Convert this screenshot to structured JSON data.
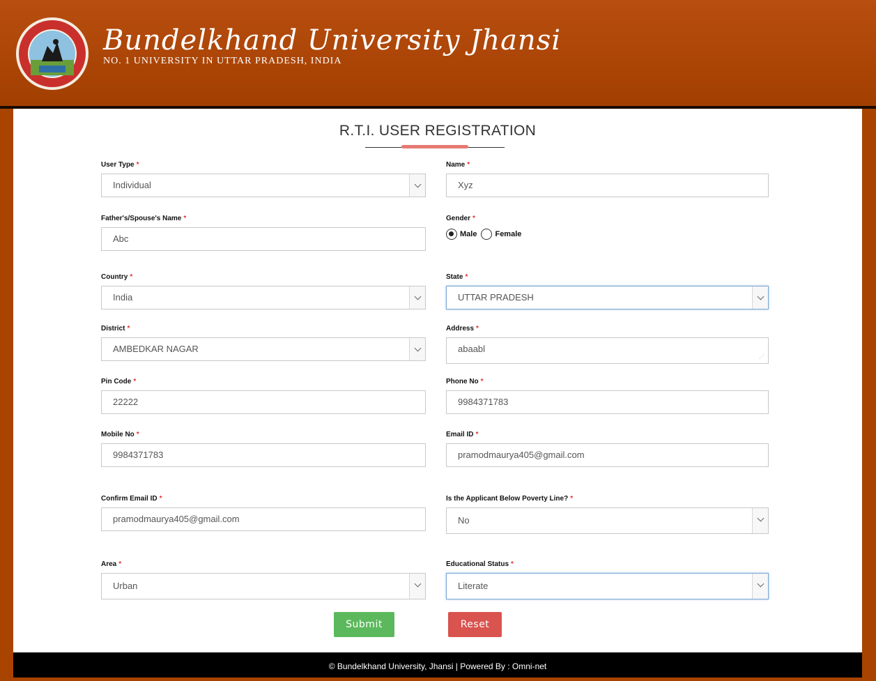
{
  "header": {
    "title": "Bundelkhand University Jhansi",
    "subtitle": "No. 1 University in Uttar Pradesh, India",
    "logo_icon": "university-seal-icon"
  },
  "page": {
    "title": "R.T.I. USER REGISTRATION"
  },
  "form": {
    "user_type": {
      "label": "User Type",
      "value": "Individual"
    },
    "name": {
      "label": "Name",
      "value": "Xyz"
    },
    "father_name": {
      "label": "Father's/Spouse's Name",
      "value": "Abc"
    },
    "gender": {
      "label": "Gender",
      "options": [
        "Male",
        "Female"
      ],
      "selected": "Male"
    },
    "country": {
      "label": "Country",
      "value": "India"
    },
    "state": {
      "label": "State",
      "value": "UTTAR PRADESH"
    },
    "district": {
      "label": "District",
      "value": "AMBEDKAR NAGAR"
    },
    "address": {
      "label": "Address",
      "value": "abaabl"
    },
    "pin_code": {
      "label": "Pin Code",
      "value": "22222"
    },
    "phone_no": {
      "label": "Phone No",
      "value": "9984371783"
    },
    "mobile_no": {
      "label": "Mobile No",
      "value": "9984371783"
    },
    "email": {
      "label": "Email ID",
      "value": "pramodmaurya405@gmail.com"
    },
    "confirm_email": {
      "label": "Confirm Email ID",
      "value": "pramodmaurya405@gmail.com"
    },
    "bpl": {
      "label": "Is the Applicant Below Poverty Line?",
      "value": "No"
    },
    "area": {
      "label": "Area",
      "value": "Urban"
    },
    "education": {
      "label": "Educational Status",
      "value": "Literate"
    },
    "required_mark": "*"
  },
  "actions": {
    "submit_label": "Submit",
    "reset_label": "Reset"
  },
  "footer": {
    "text": "© Bundelkhand University, Jhansi | Powered By : Omni-net"
  },
  "colors": {
    "header_bg": "#a84400",
    "submit": "#5cb85c",
    "reset": "#d9534f",
    "required": "#e3342f",
    "accent": "#e57a73"
  }
}
